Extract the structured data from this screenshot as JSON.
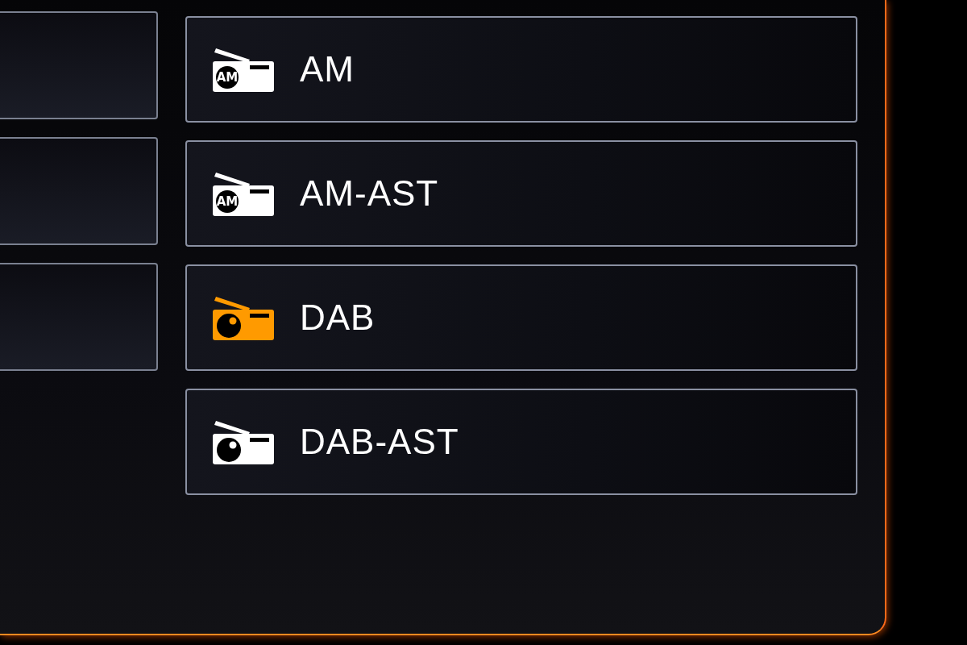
{
  "left_column": [
    {
      "kind": "blank"
    },
    {
      "kind": "blank"
    },
    {
      "kind": "blank"
    }
  ],
  "sources": [
    {
      "label": "AM",
      "kind": "am",
      "badge": "AM",
      "selected": false
    },
    {
      "label": "AM-AST",
      "kind": "am",
      "badge": "AM",
      "selected": false
    },
    {
      "label": "DAB",
      "kind": "dab",
      "selected": true
    },
    {
      "label": "DAB-AST",
      "kind": "dab",
      "selected": false
    }
  ]
}
